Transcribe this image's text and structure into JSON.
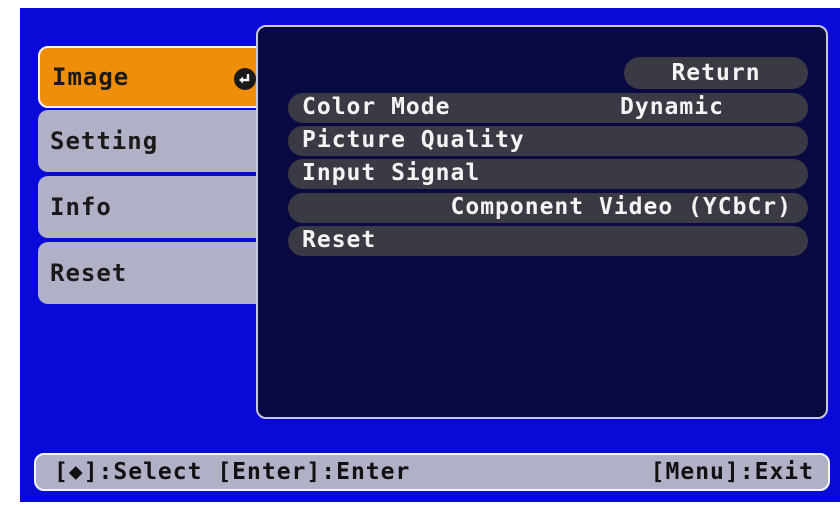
{
  "colors": {
    "screen_bg": "#0a0ad8",
    "panel_bg": "#0a0a42",
    "active_tab": "#f08e0a",
    "inactive_tab": "#b0b0c6",
    "row_bg": "#3a3a44"
  },
  "tabs": [
    {
      "label": "Image",
      "active": true,
      "icon": "enter-return-icon"
    },
    {
      "label": "Setting",
      "active": false
    },
    {
      "label": "Info",
      "active": false
    },
    {
      "label": "Reset",
      "active": false
    }
  ],
  "panel": {
    "return_label": "Return",
    "items": [
      {
        "label": "Color Mode",
        "value": "Dynamic"
      },
      {
        "label": "Picture Quality",
        "value": ""
      },
      {
        "label": "Input Signal",
        "value": ""
      },
      {
        "label": "",
        "value": "Component Video (YCbCr)"
      },
      {
        "label": "Reset",
        "value": ""
      }
    ]
  },
  "footer": {
    "left_text": "[◆]:Select [Enter]:Enter",
    "right_text": "[Menu]:Exit"
  }
}
